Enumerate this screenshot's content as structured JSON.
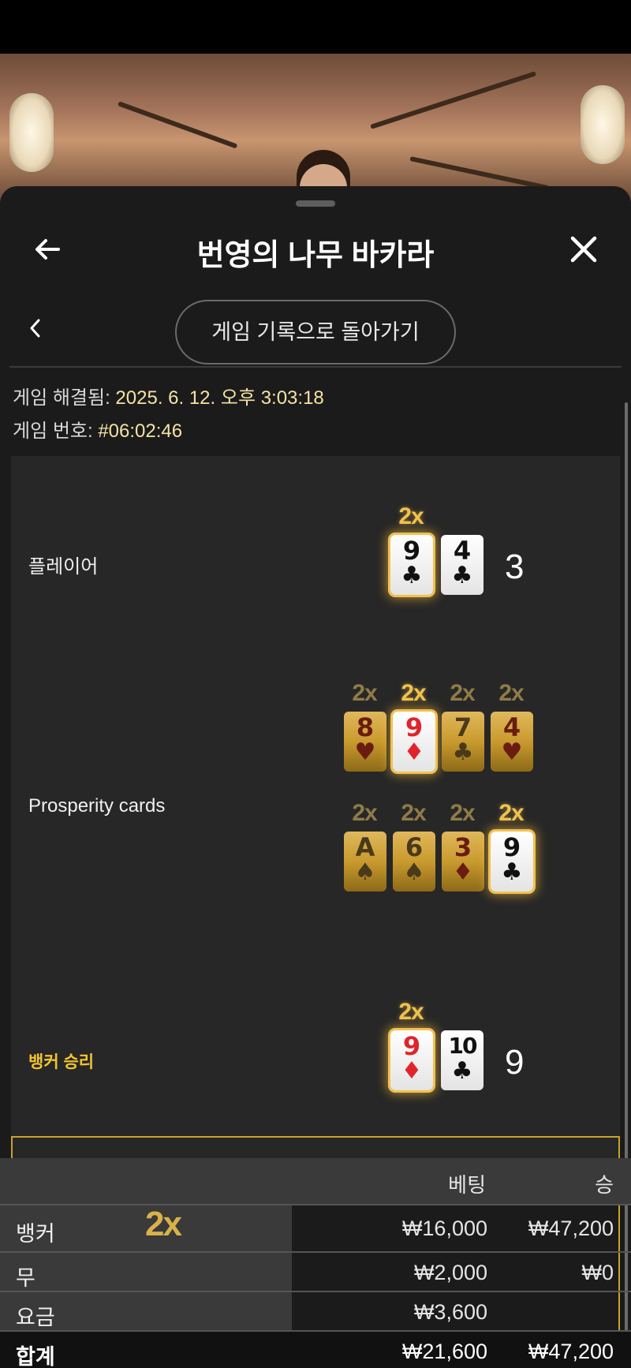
{
  "window": {
    "title": "번영의 나무 바카라"
  },
  "nav": {
    "return_label": "게임 기록으로 돌아가기"
  },
  "info": {
    "resolved_label": "게임 해결됨:",
    "resolved_value": "2025. 6. 12. 오후 3:03:18",
    "number_label": "게임 번호:",
    "number_value": "#06:02:46"
  },
  "rows": {
    "player": {
      "label": "플레이어",
      "score": "3",
      "cards": [
        {
          "rank": "9",
          "suit": "♣",
          "color": "black",
          "multiplier": "2x",
          "highlighted": true
        },
        {
          "rank": "4",
          "suit": "♣",
          "color": "black",
          "multiplier": "",
          "highlighted": false
        }
      ]
    },
    "prosperity": {
      "label": "Prosperity cards",
      "top": [
        {
          "rank": "8",
          "suit": "♥",
          "color": "red",
          "multiplier": "2x",
          "highlighted": false
        },
        {
          "rank": "9",
          "suit": "♦",
          "color": "red",
          "multiplier": "2x",
          "highlighted": true
        },
        {
          "rank": "7",
          "suit": "♣",
          "color": "black",
          "multiplier": "2x",
          "highlighted": false
        },
        {
          "rank": "4",
          "suit": "♥",
          "color": "red",
          "multiplier": "2x",
          "highlighted": false
        }
      ],
      "bottom": [
        {
          "rank": "A",
          "suit": "♠",
          "color": "black",
          "multiplier": "2x",
          "highlighted": false
        },
        {
          "rank": "6",
          "suit": "♠",
          "color": "black",
          "multiplier": "2x",
          "highlighted": false
        },
        {
          "rank": "3",
          "suit": "♦",
          "color": "red",
          "multiplier": "2x",
          "highlighted": false
        },
        {
          "rank": "9",
          "suit": "♣",
          "color": "black",
          "multiplier": "2x",
          "highlighted": true
        }
      ]
    },
    "banker": {
      "label": "뱅커 승리",
      "score": "9",
      "cards": [
        {
          "rank": "9",
          "suit": "♦",
          "color": "red",
          "multiplier": "2x",
          "highlighted": true
        },
        {
          "rank": "10",
          "suit": "♣",
          "color": "black",
          "multiplier": "",
          "highlighted": false
        }
      ]
    }
  },
  "bets": {
    "headers": {
      "bet": "베팅",
      "win": "승"
    },
    "rows": [
      {
        "label": "뱅커",
        "multiplier": "2x",
        "bet": "₩16,000",
        "win": "₩47,200"
      },
      {
        "label": "무",
        "bet": "₩2,000",
        "win": "₩0"
      },
      {
        "label": "요금",
        "bet": "₩3,600",
        "win": ""
      }
    ],
    "total": {
      "label": "합계",
      "bet": "₩21,600",
      "win": "₩47,200"
    }
  },
  "colors": {
    "accent_gold": "#f0c24c",
    "banker_label": "#f2c530",
    "panel_bg": "#1b1b1b"
  }
}
